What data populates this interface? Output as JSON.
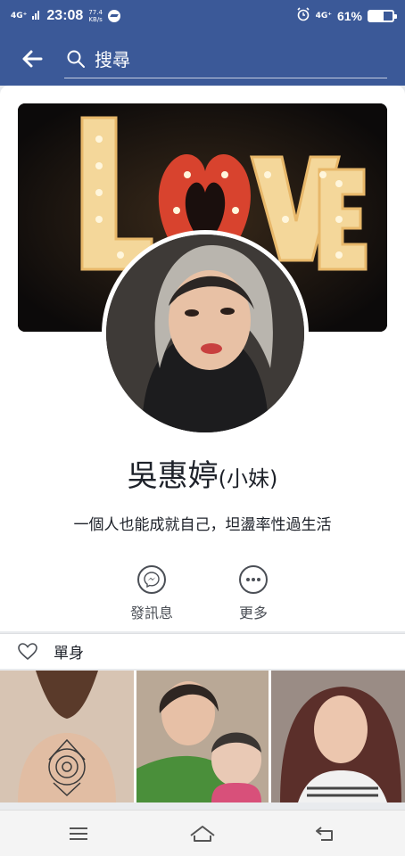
{
  "status_bar": {
    "network_left": "4G⁺",
    "time": "23:08",
    "speed_value": "77.4",
    "speed_unit": "KB/s",
    "network_right": "4G⁺",
    "battery_percent": "61%",
    "battery_level": 0.61
  },
  "header": {
    "search_placeholder": "搜尋",
    "color": "#3b5998"
  },
  "profile": {
    "cover_text": "LOVE",
    "name": "吳惠婷",
    "alternate_name": "(小妹)",
    "bio": "一個人也能成就自己，坦盪率性過生活"
  },
  "actions": [
    {
      "label": "發訊息",
      "icon": "messenger-icon"
    },
    {
      "label": "更多",
      "icon": "more-icon"
    }
  ],
  "relationship": {
    "label": "單身",
    "icon": "heart-icon"
  },
  "photos": [
    {
      "icon": "photo-tattoo"
    },
    {
      "icon": "photo-selfie-with-child"
    },
    {
      "icon": "photo-selfie"
    }
  ],
  "nav": [
    {
      "icon": "menu-icon"
    },
    {
      "icon": "home-icon"
    },
    {
      "icon": "back-icon"
    }
  ]
}
